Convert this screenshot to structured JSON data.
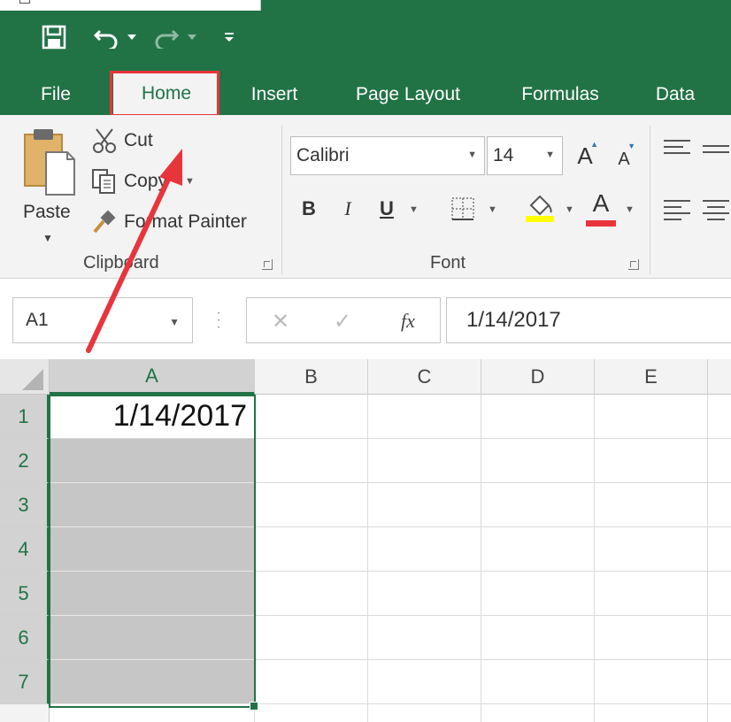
{
  "qat": {
    "save_icon": "save-icon",
    "undo_icon": "undo-icon",
    "redo_icon": "redo-icon",
    "customize_icon": "customize-qat-icon"
  },
  "tabs": [
    {
      "label": "File"
    },
    {
      "label": "Home"
    },
    {
      "label": "Insert"
    },
    {
      "label": "Page Layout"
    },
    {
      "label": "Formulas"
    },
    {
      "label": "Data"
    }
  ],
  "ribbon": {
    "clipboard": {
      "paste_label": "Paste",
      "cut_label": "Cut",
      "copy_label": "Copy",
      "format_painter_label": "Format Painter",
      "group_label": "Clipboard"
    },
    "font": {
      "font_name": "Calibri",
      "font_size": "14",
      "grow_label": "A",
      "shrink_label": "A",
      "bold_label": "B",
      "italic_label": "I",
      "underline_label": "U",
      "font_color_label": "A",
      "group_label": "Font",
      "highlight_color": "#ffff00",
      "font_color": "#e8353b"
    }
  },
  "formula_bar": {
    "name_box": "A1",
    "cancel_glyph": "✕",
    "enter_glyph": "✓",
    "fx_label": "fx",
    "value": "1/14/2017"
  },
  "sheet": {
    "columns": [
      "A",
      "B",
      "C",
      "D",
      "E"
    ],
    "rows": [
      "1",
      "2",
      "3",
      "4",
      "5",
      "6",
      "7"
    ],
    "cells": {
      "A1": "1/14/2017"
    }
  },
  "colors": {
    "brand": "#217346",
    "annotation": "#e8353b"
  }
}
